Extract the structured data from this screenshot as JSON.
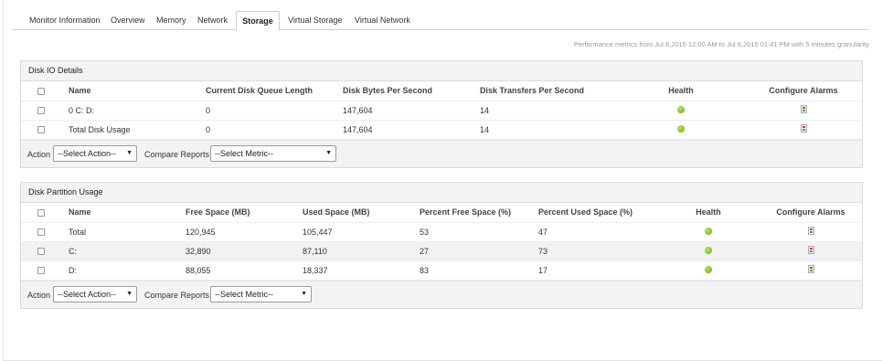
{
  "tabs": [
    {
      "label": "Monitor Information"
    },
    {
      "label": "Overview"
    },
    {
      "label": "Memory"
    },
    {
      "label": "Network"
    },
    {
      "label": "Storage"
    },
    {
      "label": "Virtual Storage"
    },
    {
      "label": "Virtual Network"
    }
  ],
  "active_tab": "Storage",
  "performance_text": "Performance metrics from Jul 8,2015 12:00 AM to Jul 8,2015 01:41 PM with 5 minutes granularity",
  "disk_io": {
    "title": "Disk IO Details",
    "columns": [
      "Name",
      "Current Disk Queue Length",
      "Disk Bytes Per Second",
      "Disk Transfers Per Second",
      "Health",
      "Configure Alarms"
    ],
    "rows": [
      {
        "name": "0 C: D:",
        "queue": "0",
        "bytes": "147,604",
        "transfers": "14",
        "health": "green"
      },
      {
        "name": "Total Disk Usage",
        "queue": "0",
        "bytes": "147,604",
        "transfers": "14",
        "health": "green"
      }
    ],
    "action_label": "Action",
    "action_select": "--Select Action--",
    "compare_label": "Compare Reports",
    "metric_select": "--Select Metric--"
  },
  "disk_partition": {
    "title": "Disk Partition Usage",
    "columns": [
      "Name",
      "Free Space  (MB)",
      "Used Space  (MB)",
      "Percent Free Space  (%)",
      "Percent Used Space  (%)",
      "Health",
      "Configure Alarms"
    ],
    "rows": [
      {
        "name": "Total",
        "free": "120,945",
        "used": "105,447",
        "pct_free": "53",
        "pct_used": "47",
        "health": "green"
      },
      {
        "name": "C:",
        "free": "32,890",
        "used": "87,110",
        "pct_free": "27",
        "pct_used": "73",
        "health": "green"
      },
      {
        "name": "D:",
        "free": "88,055",
        "used": "18,337",
        "pct_free": "83",
        "pct_used": "17",
        "health": "green"
      }
    ],
    "action_label": "Action",
    "action_select": "--Select Action--",
    "compare_label": "Compare Reports",
    "metric_select": "--Select Metric--"
  },
  "colors": {
    "health_ok": "#7cbf1f",
    "panel_header_bg": "#f3f3f3",
    "border": "#dcdcdc"
  },
  "icons": {
    "checkbox": "checkbox-icon",
    "health": "health-status-icon",
    "alarm": "configure-alarm-icon",
    "dropdown": "chevron-down-icon"
  }
}
